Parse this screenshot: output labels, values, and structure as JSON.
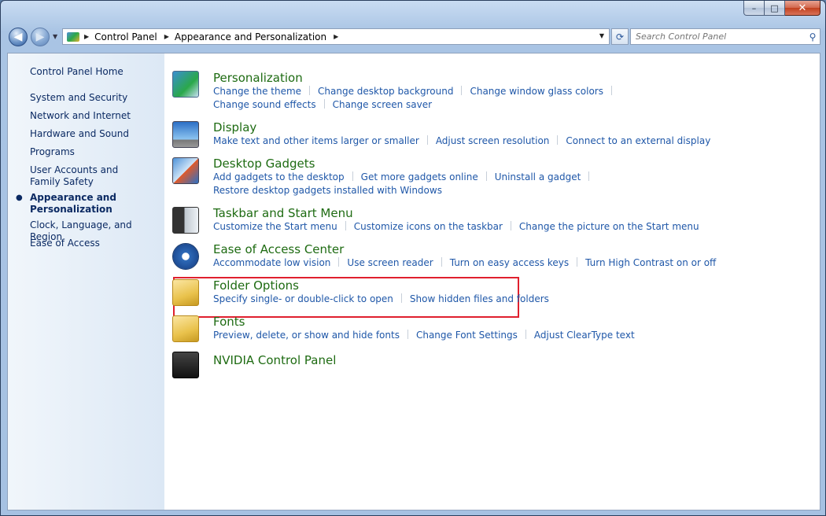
{
  "window": {
    "caption": {
      "minimize": "–",
      "maximize": "□",
      "close": "✕"
    }
  },
  "nav": {
    "back_glyph": "◀",
    "forward_glyph": "▶",
    "breadcrumbs": [
      "Control Panel",
      "Appearance and Personalization"
    ],
    "search_placeholder": "Search Control Panel",
    "refresh_glyph": "⟳",
    "search_glyph": "⚲"
  },
  "sidebar": {
    "home": "Control Panel Home",
    "items": [
      {
        "label": "System and Security"
      },
      {
        "label": "Network and Internet"
      },
      {
        "label": "Hardware and Sound"
      },
      {
        "label": "Programs"
      },
      {
        "label": "User Accounts and Family Safety"
      },
      {
        "label": "Appearance and Personalization",
        "current": true
      },
      {
        "label": "Clock, Language, and Region"
      },
      {
        "label": "Ease of Access"
      }
    ],
    "bullet": "●"
  },
  "categories": [
    {
      "title": "Personalization",
      "icon": "personalization-icon",
      "link_rows": [
        [
          "Change the theme",
          "Change desktop background",
          "Change window glass colors"
        ],
        [
          "Change sound effects",
          "Change screen saver"
        ]
      ]
    },
    {
      "title": "Display",
      "icon": "display-icon",
      "link_rows": [
        [
          "Make text and other items larger or smaller",
          "Adjust screen resolution",
          "Connect to an external display"
        ]
      ]
    },
    {
      "title": "Desktop Gadgets",
      "icon": "gadgets-icon",
      "link_rows": [
        [
          "Add gadgets to the desktop",
          "Get more gadgets online",
          "Uninstall a gadget"
        ],
        [
          "Restore desktop gadgets installed with Windows"
        ]
      ]
    },
    {
      "title": "Taskbar and Start Menu",
      "icon": "taskbar-icon",
      "link_rows": [
        [
          "Customize the Start menu",
          "Customize icons on the taskbar",
          "Change the picture on the Start menu"
        ]
      ]
    },
    {
      "title": "Ease of Access Center",
      "icon": "ease-of-access-icon",
      "link_rows": [
        [
          "Accommodate low vision",
          "Use screen reader",
          "Turn on easy access keys",
          "Turn High Contrast on or off"
        ]
      ]
    },
    {
      "title": "Folder Options",
      "icon": "folder-options-icon",
      "link_rows": [
        [
          "Specify single- or double-click to open",
          "Show hidden files and folders"
        ]
      ]
    },
    {
      "title": "Fonts",
      "icon": "fonts-icon",
      "link_rows": [
        [
          "Preview, delete, or show and hide fonts",
          "Change Font Settings",
          "Adjust ClearType text"
        ]
      ]
    },
    {
      "title": "NVIDIA Control Panel",
      "icon": "nvidia-icon",
      "link_rows": []
    }
  ]
}
